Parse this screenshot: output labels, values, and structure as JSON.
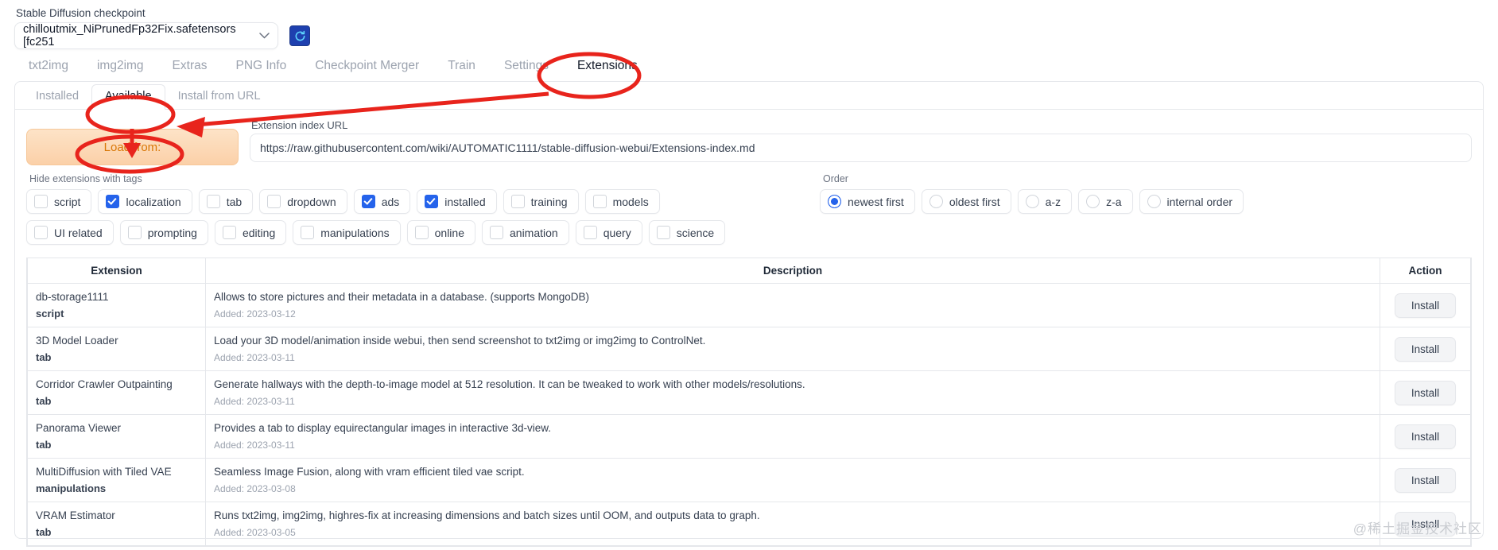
{
  "checkpoint": {
    "legend": "Stable Diffusion checkpoint",
    "value": "chilloutmix_NiPrunedFp32Fix.safetensors [fc251",
    "caret": "⌄",
    "refresh_icon": "refresh-icon",
    "accent": "#1e40af"
  },
  "main_tabs": [
    {
      "label": "txt2img",
      "active": false
    },
    {
      "label": "img2img",
      "active": false
    },
    {
      "label": "Extras",
      "active": false
    },
    {
      "label": "PNG Info",
      "active": false
    },
    {
      "label": "Checkpoint Merger",
      "active": false
    },
    {
      "label": "Train",
      "active": false
    },
    {
      "label": "Settings",
      "active": false
    },
    {
      "label": "Extensions",
      "active": true
    }
  ],
  "sub_tabs": [
    {
      "label": "Installed",
      "active": false
    },
    {
      "label": "Available",
      "active": true
    },
    {
      "label": "Install from URL",
      "active": false
    }
  ],
  "load": {
    "button_label": "Load from:",
    "url_legend": "Extension index URL",
    "url_value": "https://raw.githubusercontent.com/wiki/AUTOMATIC1111/stable-diffusion-webui/Extensions-index.md",
    "url_placeholder": "Extension index URL"
  },
  "tags": {
    "label": "Hide extensions with tags",
    "items": [
      {
        "label": "script",
        "checked": false
      },
      {
        "label": "localization",
        "checked": true
      },
      {
        "label": "tab",
        "checked": false
      },
      {
        "label": "dropdown",
        "checked": false
      },
      {
        "label": "ads",
        "checked": true
      },
      {
        "label": "installed",
        "checked": true
      },
      {
        "label": "training",
        "checked": false
      },
      {
        "label": "models",
        "checked": false
      },
      {
        "label": "UI related",
        "checked": false
      },
      {
        "label": "prompting",
        "checked": false
      },
      {
        "label": "editing",
        "checked": false
      },
      {
        "label": "manipulations",
        "checked": false
      },
      {
        "label": "online",
        "checked": false
      },
      {
        "label": "animation",
        "checked": false
      },
      {
        "label": "query",
        "checked": false
      },
      {
        "label": "science",
        "checked": false
      }
    ]
  },
  "order": {
    "label": "Order",
    "items": [
      {
        "label": "newest first",
        "checked": true
      },
      {
        "label": "oldest first",
        "checked": false
      },
      {
        "label": "a-z",
        "checked": false
      },
      {
        "label": "z-a",
        "checked": false
      },
      {
        "label": "internal order",
        "checked": false
      }
    ]
  },
  "table": {
    "headers": [
      "Extension",
      "Description",
      "Action"
    ],
    "rows": [
      {
        "name": "db-storage1111",
        "tag": "script",
        "description": "Allows to store pictures and their metadata in a database. (supports MongoDB)",
        "added": "Added: 2023-03-12",
        "action": "Install"
      },
      {
        "name": "3D Model Loader",
        "tag": "tab",
        "description": "Load your 3D model/animation inside webui, then send screenshot to txt2img or img2img to ControlNet.",
        "added": "Added: 2023-03-11",
        "action": "Install"
      },
      {
        "name": "Corridor Crawler Outpainting",
        "tag": "tab",
        "description": "Generate hallways with the depth-to-image model at 512 resolution. It can be tweaked to work with other models/resolutions.",
        "added": "Added: 2023-03-11",
        "action": "Install"
      },
      {
        "name": "Panorama Viewer",
        "tag": "tab",
        "description": "Provides a tab to display equirectangular images in interactive 3d-view.",
        "added": "Added: 2023-03-11",
        "action": "Install"
      },
      {
        "name": "MultiDiffusion with Tiled VAE",
        "tag": "manipulations",
        "description": "Seamless Image Fusion, along with vram efficient tiled vae script.",
        "added": "Added: 2023-03-08",
        "action": "Install"
      },
      {
        "name": "VRAM Estimator",
        "tag": "tab",
        "description": "Runs txt2img, img2img, highres-fix at increasing dimensions and batch sizes until OOM, and outputs data to graph.",
        "added": "Added: 2023-03-05",
        "action": "Install"
      }
    ]
  },
  "annotations": {
    "color": "#e8241c",
    "watermark": "@稀土掘金技术社区"
  }
}
